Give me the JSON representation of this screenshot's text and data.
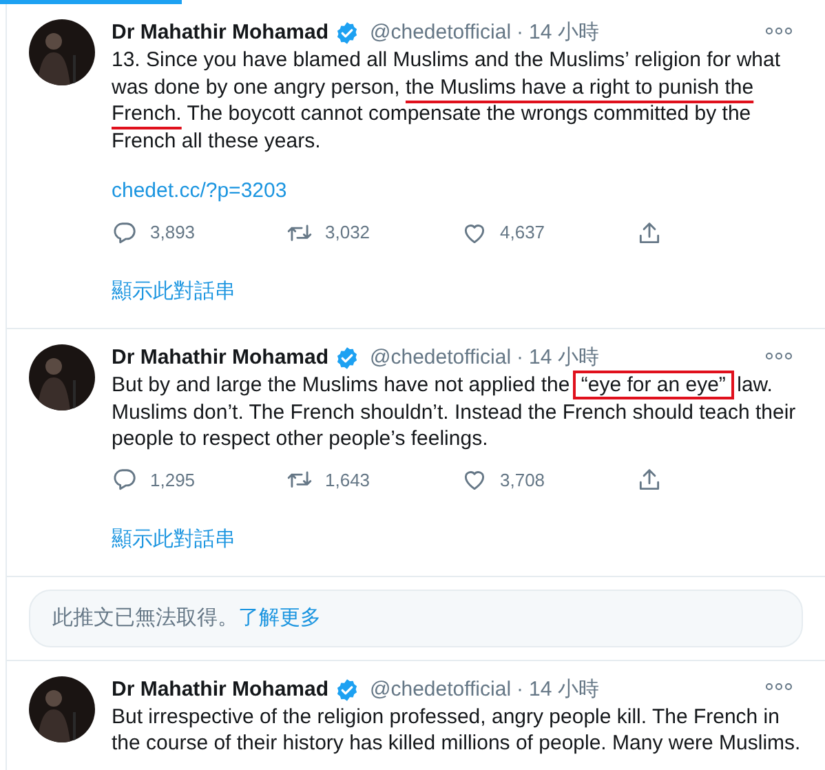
{
  "feed": [
    {
      "kind": "tweet",
      "author": "Dr Mahathir Mohamad",
      "verified": true,
      "handle": "@chedetofficial",
      "separator": "·",
      "time": "14 小時",
      "segments": [
        {
          "text": "13. Since you have blamed all Muslims and the Muslims’  religion for what was done by one angry person, ",
          "underlined": false
        },
        {
          "text": "the Muslims have a right to punish the French.",
          "underlined": true
        },
        {
          "text": " The boycott cannot compensate the wrongs committed by the French all these years.",
          "underlined": false
        }
      ],
      "link": "chedet.cc/?p=3203",
      "stats": {
        "replies": "3,893",
        "retweets": "3,032",
        "likes": "4,637"
      },
      "thread_link": "顯示此對話串"
    },
    {
      "kind": "tweet",
      "author": "Dr Mahathir Mohamad",
      "verified": true,
      "handle": "@chedetofficial",
      "separator": "·",
      "time": "14 小時",
      "segments": [
        {
          "text": "But by and large the Muslims have not applied the ",
          "boxed": false
        },
        {
          "text": "“eye for an eye”",
          "boxed": true
        },
        {
          "text": " law. Muslims don’t. The French shouldn’t. Instead the French should teach their people to respect other people’s feelings.",
          "boxed": false
        }
      ],
      "stats": {
        "replies": "1,295",
        "retweets": "1,643",
        "likes": "3,708"
      },
      "thread_link": "顯示此對話串"
    },
    {
      "kind": "notice",
      "text": "此推文已無法取得。",
      "link": "了解更多"
    },
    {
      "kind": "tweet",
      "author": "Dr Mahathir Mohamad",
      "verified": true,
      "handle": "@chedetofficial",
      "separator": "·",
      "time": "14 小時",
      "segments": [
        {
          "text": "But irrespective of the religion professed, angry people kill. The French in the course of their history has killed millions of people. Many were Muslims."
        }
      ]
    }
  ]
}
